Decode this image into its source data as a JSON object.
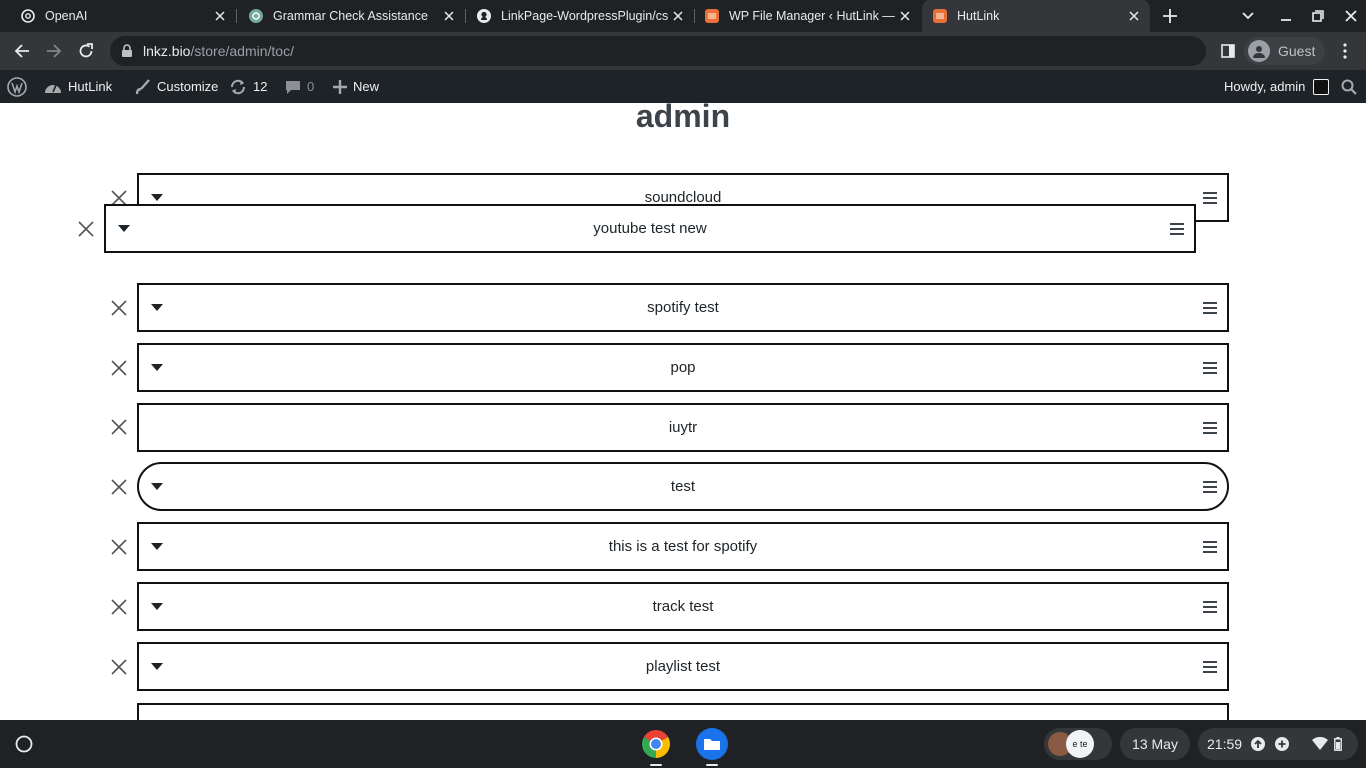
{
  "browser": {
    "tabs": [
      {
        "title": "OpenAI",
        "icon": "openai-icon",
        "active": false
      },
      {
        "title": "Grammar Check Assistance",
        "icon": "openai-icon",
        "active": false
      },
      {
        "title": "LinkPage-WordpressPlugin/cs",
        "icon": "github-icon",
        "active": false
      },
      {
        "title": "WP File Manager ‹ HutLink — V",
        "icon": "hutlink-icon",
        "active": false
      },
      {
        "title": "HutLink",
        "icon": "hutlink-icon",
        "active": true
      }
    ],
    "url_host": "lnkz.bio",
    "url_path": "/store/admin/toc/",
    "profile_label": "Guest"
  },
  "adminbar": {
    "site_name": "HutLink",
    "customize_label": "Customize",
    "updates_count": "12",
    "comments_count": "0",
    "new_label": "New",
    "howdy_label": "Howdy, admin"
  },
  "page": {
    "heading": "admin",
    "rows": [
      {
        "label": "soundcloud",
        "caret": true
      },
      {
        "label": "youtube test new",
        "caret": true,
        "dragging": true
      },
      {
        "label": "spotify test",
        "caret": true
      },
      {
        "label": "pop",
        "caret": true
      },
      {
        "label": "iuytr",
        "caret": false
      },
      {
        "label": "test",
        "caret": true,
        "rounded": true
      },
      {
        "label": "this is a test for spotify",
        "caret": true
      },
      {
        "label": "track test",
        "caret": true
      },
      {
        "label": "playlist test",
        "caret": true
      }
    ]
  },
  "shelf": {
    "date": "13 May",
    "time": "21:59",
    "notification_text": "e te"
  },
  "colors": {
    "tabstrip_bg": "#202124",
    "toolbar_bg": "#35363a",
    "adminbar_bg": "#1d2327",
    "hutlink_orange": "#e8703a"
  }
}
